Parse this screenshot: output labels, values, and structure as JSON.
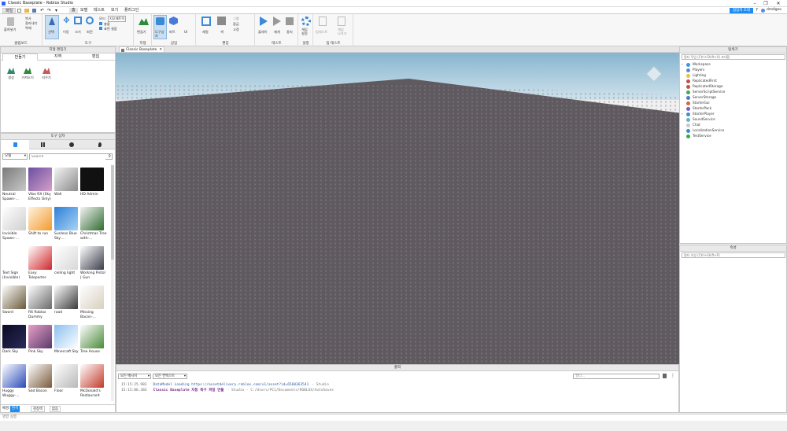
{
  "window": {
    "title": "Classic Baseplate - Roblox Studio",
    "min": "–",
    "max": "❐",
    "close": "✕"
  },
  "menu": {
    "file": "파일",
    "items": [
      "홈",
      "모델",
      "테스트",
      "보기",
      "플러그인"
    ],
    "share": "협업자 초대",
    "user": "dmdlgeo"
  },
  "ribbon": {
    "clipboard": {
      "label": "클립보드",
      "paste": "붙여넣기",
      "copy": "복사",
      "cut": "잘라내기",
      "dup": "복제"
    },
    "tools": {
      "label": "도구",
      "select": "선택",
      "move": "이동",
      "scale": "크기",
      "rotate": "회전",
      "mode": "모드:",
      "mode_val": "지오메트릭",
      "collide": "충돌",
      "join": "표면 결합"
    },
    "terrain": {
      "label": "지형",
      "editor": "편집기"
    },
    "insert": {
      "label": "삽입",
      "toolbox": "도구상자",
      "part": "파트",
      "ui": "UI"
    },
    "edit": {
      "label": "편집",
      "material": "재질",
      "color": "색",
      "group": "그룹",
      "lock": "잠금",
      "anchor": "고정"
    },
    "test": {
      "label": "테스트",
      "play": "플레이",
      "resume": "재개",
      "stop": "중지"
    },
    "settings": {
      "label": "설정",
      "game": "게임\n설정"
    },
    "team": {
      "label": "팀 테스트",
      "teamtest": "팀테스트",
      "exit": "게임\n나가기"
    }
  },
  "terrain_panel": {
    "title": "지형 편집기",
    "tabs": [
      "만들기",
      "지역",
      "편집"
    ],
    "tools": [
      "생성",
      "가져오기",
      "지우기"
    ]
  },
  "toolbox": {
    "title": "도구 상자",
    "category": "모델",
    "search_placeholder": "Search",
    "items": [
      {
        "name": "Neutral Spawn-...",
        "c1": "#7a7a7a",
        "c2": "#c9c9c9"
      },
      {
        "name": "Vibe RX (Sky Effects Only)",
        "c1": "#6a4fa1",
        "c2": "#d6a0c9"
      },
      {
        "name": "Wall",
        "c1": "#f5f5f5",
        "c2": "#8a8a8a"
      },
      {
        "name": "HD Admin",
        "c1": "#111111",
        "c2": "#111111"
      },
      {
        "name": "Invisible Spawn-...",
        "c1": "#ffffff",
        "c2": "#cfcfcf"
      },
      {
        "name": "Shift to run",
        "c1": "#fff3e0",
        "c2": "#f29a2e"
      },
      {
        "name": "Sunless Blue Sky-...",
        "c1": "#2f7fd8",
        "c2": "#a8d4f5"
      },
      {
        "name": "Christmas Tree with-...",
        "c1": "#f4f4f4",
        "c2": "#2f6b2f"
      },
      {
        "name": "Text Sign (Invisible)",
        "c1": "#ffffff",
        "c2": "#ffffff"
      },
      {
        "name": "Easy Teleporter",
        "c1": "#ffffff",
        "c2": "#d0262a"
      },
      {
        "name": "ceiling light",
        "c1": "#ffffff",
        "c2": "#d8d8d8"
      },
      {
        "name": "Working Pistol | Gun",
        "c1": "#ffffff",
        "c2": "#3a3d4a"
      },
      {
        "name": "Sword",
        "c1": "#ffffff",
        "c2": "#6a5a3a"
      },
      {
        "name": "R6 Roblox Dummy",
        "c1": "#ffffff",
        "c2": "#6a6a6a"
      },
      {
        "name": "road",
        "c1": "#ffffff",
        "c2": "#3a3a3a"
      },
      {
        "name": "Missing Bacon-...",
        "c1": "#ffffff",
        "c2": "#d8d0c0"
      },
      {
        "name": "Dark Sky",
        "c1": "#0a0a22",
        "c2": "#2a2a5a"
      },
      {
        "name": "Pink Sky",
        "c1": "#e7a0c8",
        "c2": "#5a3a6a"
      },
      {
        "name": "Minecraft Sky",
        "c1": "#8cc0ef",
        "c2": "#ffffff"
      },
      {
        "name": "Tree House",
        "c1": "#ffffff",
        "c2": "#4a8a3a"
      },
      {
        "name": "Huggy Wuggy-...",
        "c1": "#ffffff",
        "c2": "#2a4ab8"
      },
      {
        "name": "Sad Bacon",
        "c1": "#ffffff",
        "c2": "#7a5a3a"
      },
      {
        "name": "Floor",
        "c1": "#ffffff",
        "c2": "#b8b8b8"
      },
      {
        "name": "McDonald's Restaurant",
        "c1": "#ffffff",
        "c2": "#c23a2a"
      }
    ],
    "bg_label": "배경:",
    "bg_white": "흰색",
    "bg_black": "검정색",
    "bg_none": "없음"
  },
  "viewport": {
    "tab": "Classic Baseplate",
    "tab_close": "✕"
  },
  "output": {
    "title": "출력",
    "all_messages": "모든 메시지",
    "all_contexts": "모든 컨텍스트",
    "filter": "필터...",
    "lines": [
      {
        "time": "15:15:25.983",
        "text": "DataModel Loading https://assetdelivery.roblox.com/v1/asset?id=6560363541",
        "ctx": "- Studio"
      },
      {
        "time": "15:15:06.383",
        "text": "Classic Baseplate 자동 복구 파일 만듦",
        "ctx": "- Studio - C:/Users/PC1/Documents/ROBLOX/AutoSaves"
      }
    ]
  },
  "explorer": {
    "title": "탐색기",
    "filter": "필터 작업 (Ctrl+Shift+X) 초대합",
    "items": [
      {
        "name": "Workspace",
        "color": "#3a9ad9",
        "arrow": true
      },
      {
        "name": "Players",
        "color": "#5a8adf",
        "arrow": false
      },
      {
        "name": "Lighting",
        "color": "#e8c440",
        "arrow": false
      },
      {
        "name": "ReplicatedFirst",
        "color": "#c0504d",
        "arrow": false
      },
      {
        "name": "ReplicatedStorage",
        "color": "#c0504d",
        "arrow": false
      },
      {
        "name": "ServerScriptService",
        "color": "#4aa84a",
        "arrow": false
      },
      {
        "name": "ServerStorage",
        "color": "#4a7ac8",
        "arrow": false
      },
      {
        "name": "StarterGui",
        "color": "#d06a3a",
        "arrow": false
      },
      {
        "name": "StarterPack",
        "color": "#7a5ac8",
        "arrow": false
      },
      {
        "name": "StarterPlayer",
        "color": "#4a8ac8",
        "arrow": true
      },
      {
        "name": "SoundService",
        "color": "#5ab8c8",
        "arrow": false
      },
      {
        "name": "Chat",
        "color": "#c8c8c8",
        "arrow": false
      },
      {
        "name": "LocalizationService",
        "color": "#3a8ad8",
        "arrow": false
      },
      {
        "name": "TestService",
        "color": "#3aa84a",
        "arrow": false
      }
    ]
  },
  "properties": {
    "title": "속성",
    "filter": "필터 속성 (Ctrl+Shift+P)"
  },
  "command": {
    "placeholder": "명령 실행"
  },
  "colors": {
    "sky_top": "#87b5cf",
    "sky_bottom": "#cfe2ec",
    "ground": "#5f5a5f",
    "accent": "#1e8cf0"
  }
}
